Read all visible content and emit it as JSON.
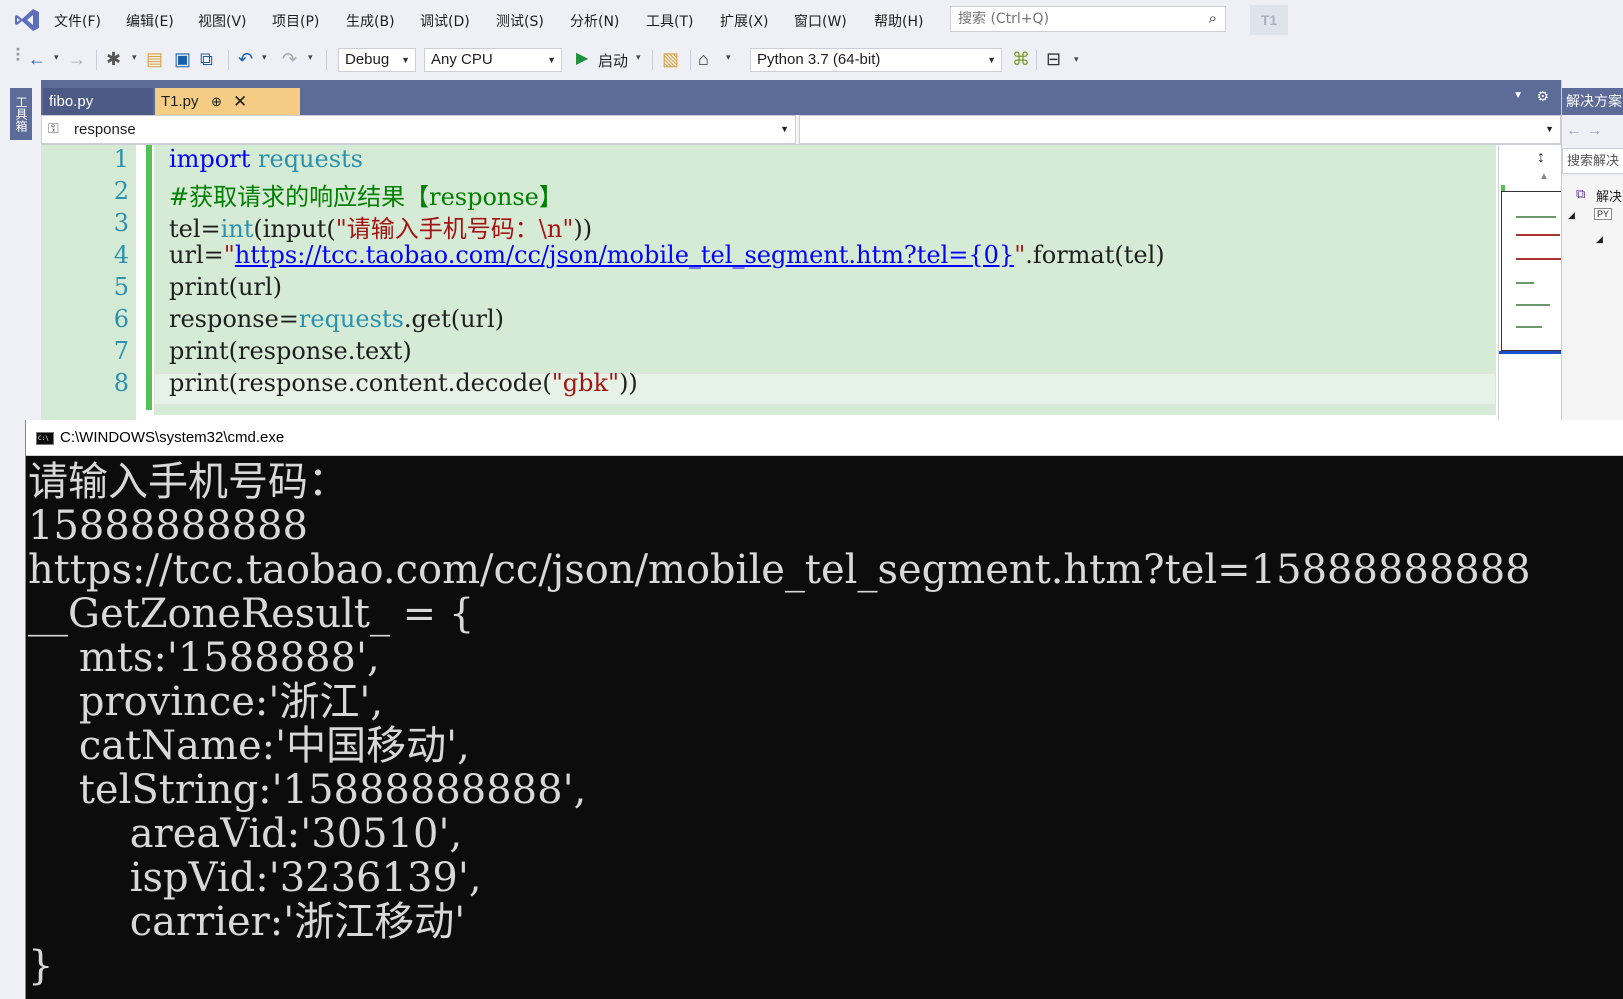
{
  "menubar": {
    "items": [
      "文件(F)",
      "编辑(E)",
      "视图(V)",
      "项目(P)",
      "生成(B)",
      "调试(D)",
      "测试(S)",
      "分析(N)",
      "工具(T)",
      "扩展(X)",
      "窗口(W)",
      "帮助(H)"
    ],
    "search_placeholder": "搜索 (Ctrl+Q)",
    "project_badge": "T1"
  },
  "toolbar": {
    "config": "Debug",
    "platform": "Any CPU",
    "start_label": "启动",
    "environment": "Python 3.7 (64-bit)"
  },
  "toolbox": {
    "label": "工具箱"
  },
  "tabs": [
    {
      "label": "fibo.py",
      "active": false
    },
    {
      "label": "T1.py",
      "active": true
    }
  ],
  "navbar": {
    "left_value": "response",
    "right_value": ""
  },
  "editor": {
    "line_numbers": [
      "1",
      "2",
      "3",
      "4",
      "5",
      "6",
      "7",
      "8"
    ],
    "lines": [
      [
        [
          "kw",
          "import"
        ],
        [
          "",
          " "
        ],
        [
          "ty",
          "requests"
        ]
      ],
      [
        [
          "cm",
          "#获取请求的响应结果【response】"
        ]
      ],
      [
        [
          "",
          "tel="
        ],
        [
          "ty",
          "int"
        ],
        [
          "",
          "(input("
        ],
        [
          "st",
          "\"请输入手机号码：\\n\""
        ],
        [
          "",
          "))"
        ]
      ],
      [
        [
          "",
          "url="
        ],
        [
          "st",
          "\""
        ],
        [
          "lk",
          "https://tcc.taobao.com/cc/json/mobile_tel_segment.htm?tel={0}"
        ],
        [
          "st",
          "\""
        ],
        [
          "",
          ".format(tel)"
        ]
      ],
      [
        [
          "",
          "print(url)"
        ]
      ],
      [
        [
          "",
          "response="
        ],
        [
          "ty",
          "requests"
        ],
        [
          "",
          ".get(url)"
        ]
      ],
      [
        [
          "",
          "print(response.text)"
        ]
      ],
      [
        [
          "",
          "print(response.content.decode("
        ],
        [
          "st",
          "\"gbk\""
        ],
        [
          "",
          "))"
        ]
      ]
    ]
  },
  "solution_explorer": {
    "title": "解决方案",
    "search_placeholder": "搜索解决",
    "tree_item": "解决"
  },
  "cmd": {
    "title": "C:\\WINDOWS\\system32\\cmd.exe",
    "output": [
      "请输入手机号码：",
      "15888888888",
      "https://tcc.taobao.com/cc/json/mobile_tel_segment.htm?tel=15888888888",
      "__GetZoneResult_ = {",
      "    mts:'1588888',",
      "    province:'浙江',",
      "    catName:'中国移动',",
      "    telString:'15888888888',",
      "        areaVid:'30510',",
      "        ispVid:'3236139',",
      "        carrier:'浙江移动'",
      "}"
    ]
  },
  "colors": {
    "accent": "#5d6b99",
    "active_tab": "#f5cc84",
    "code_background": "#d6ebd6",
    "console_background": "#0c0c0c"
  }
}
